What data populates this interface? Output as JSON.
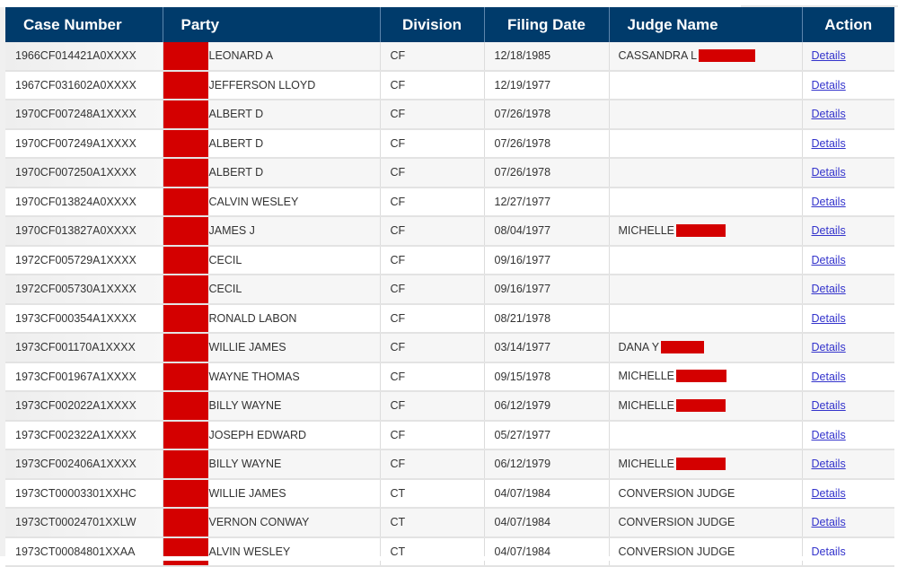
{
  "table": {
    "headers": {
      "case_number": "Case Number",
      "party": "Party",
      "division": "Division",
      "filing_date": "Filing Date",
      "judge_name": "Judge Name",
      "action": "Action"
    },
    "header_color": "#003b6b",
    "redaction_color": "#d40000",
    "link_color": "#3333cc",
    "rows": [
      {
        "case_number": "1966CF014421A0XXXX",
        "party": "LEONARD A",
        "division": "CF",
        "filing_date": "12/18/1985",
        "judge_name": "CASSANDRA L",
        "judge_redacted": true,
        "action": "Details"
      },
      {
        "case_number": "1967CF031602A0XXXX",
        "party": "JEFFERSON LLOYD",
        "division": "CF",
        "filing_date": "12/19/1977",
        "judge_name": "",
        "judge_redacted": false,
        "action": "Details"
      },
      {
        "case_number": "1970CF007248A1XXXX",
        "party": "ALBERT D",
        "division": "CF",
        "filing_date": "07/26/1978",
        "judge_name": "",
        "judge_redacted": false,
        "action": "Details"
      },
      {
        "case_number": "1970CF007249A1XXXX",
        "party": "ALBERT D",
        "division": "CF",
        "filing_date": "07/26/1978",
        "judge_name": "",
        "judge_redacted": false,
        "action": "Details"
      },
      {
        "case_number": "1970CF007250A1XXXX",
        "party": "ALBERT D",
        "division": "CF",
        "filing_date": "07/26/1978",
        "judge_name": "",
        "judge_redacted": false,
        "action": "Details"
      },
      {
        "case_number": "1970CF013824A0XXXX",
        "party": "CALVIN WESLEY",
        "division": "CF",
        "filing_date": "12/27/1977",
        "judge_name": "",
        "judge_redacted": false,
        "action": "Details"
      },
      {
        "case_number": "1970CF013827A0XXXX",
        "party": "JAMES J",
        "division": "CF",
        "filing_date": "08/04/1977",
        "judge_name": "MICHELLE",
        "judge_redacted": true,
        "action": "Details"
      },
      {
        "case_number": "1972CF005729A1XXXX",
        "party": "CECIL",
        "division": "CF",
        "filing_date": "09/16/1977",
        "judge_name": "",
        "judge_redacted": false,
        "action": "Details"
      },
      {
        "case_number": "1972CF005730A1XXXX",
        "party": "CECIL",
        "division": "CF",
        "filing_date": "09/16/1977",
        "judge_name": "",
        "judge_redacted": false,
        "action": "Details"
      },
      {
        "case_number": "1973CF000354A1XXXX",
        "party": "RONALD LABON",
        "division": "CF",
        "filing_date": "08/21/1978",
        "judge_name": "",
        "judge_redacted": false,
        "action": "Details"
      },
      {
        "case_number": "1973CF001170A1XXXX",
        "party": "WILLIE JAMES",
        "division": "CF",
        "filing_date": "03/14/1977",
        "judge_name": "DANA Y",
        "judge_redacted": true,
        "action": "Details"
      },
      {
        "case_number": "1973CF001967A1XXXX",
        "party": "WAYNE THOMAS",
        "division": "CF",
        "filing_date": "09/15/1978",
        "judge_name": "MICHELLE",
        "judge_redacted": true,
        "action": "Details"
      },
      {
        "case_number": "1973CF002022A1XXXX",
        "party": "BILLY WAYNE",
        "division": "CF",
        "filing_date": "06/12/1979",
        "judge_name": "MICHELLE",
        "judge_redacted": true,
        "action": "Details"
      },
      {
        "case_number": "1973CF002322A1XXXX",
        "party": "JOSEPH EDWARD",
        "division": "CF",
        "filing_date": "05/27/1977",
        "judge_name": "",
        "judge_redacted": false,
        "action": "Details"
      },
      {
        "case_number": "1973CF002406A1XXXX",
        "party": "BILLY WAYNE",
        "division": "CF",
        "filing_date": "06/12/1979",
        "judge_name": "MICHELLE",
        "judge_redacted": true,
        "action": "Details"
      },
      {
        "case_number": "1973CT00003301XXHC",
        "party": "WILLIE JAMES",
        "division": "CT",
        "filing_date": "04/07/1984",
        "judge_name": "CONVERSION JUDGE",
        "judge_redacted": false,
        "action": "Details"
      },
      {
        "case_number": "1973CT00024701XXLW",
        "party": "VERNON CONWAY",
        "division": "CT",
        "filing_date": "04/07/1984",
        "judge_name": "CONVERSION JUDGE",
        "judge_redacted": false,
        "action": "Details"
      },
      {
        "case_number": "1973CT00084801XXAA",
        "party": "ALVIN WESLEY",
        "division": "CT",
        "filing_date": "04/07/1984",
        "judge_name": "CONVERSION JUDGE",
        "judge_redacted": false,
        "action": "Details"
      }
    ]
  }
}
